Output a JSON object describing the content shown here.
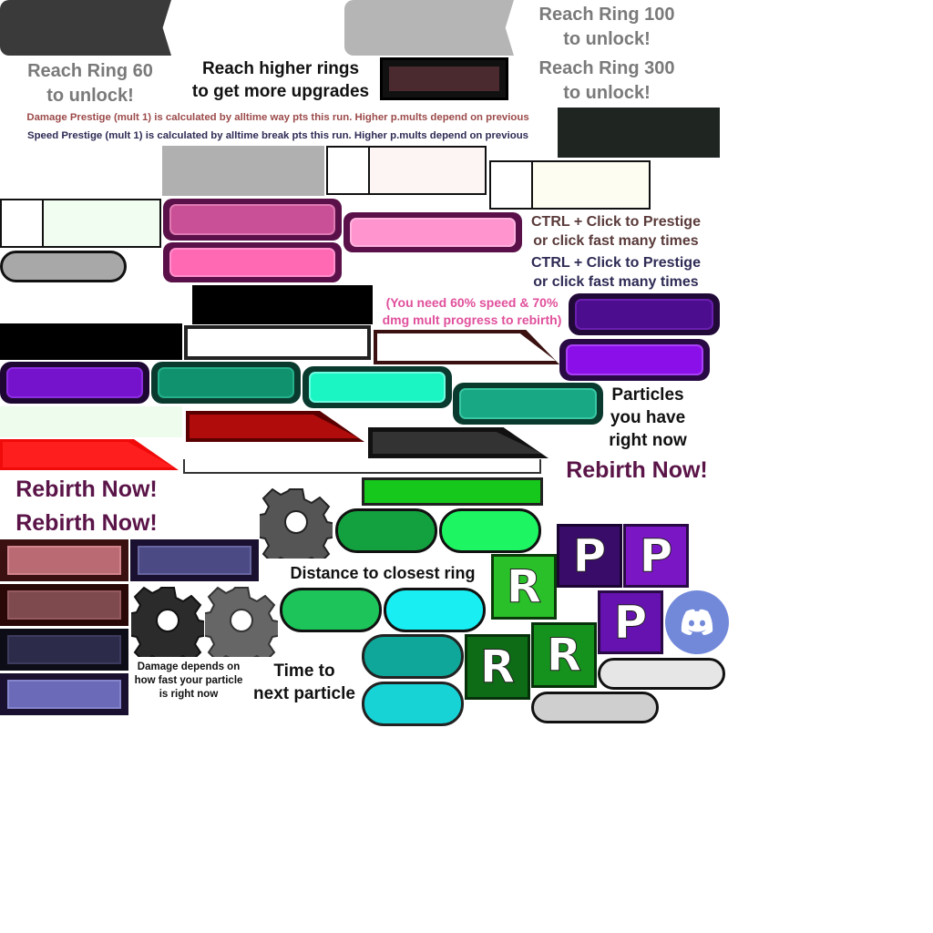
{
  "unlock_labels": {
    "ring60_line1": "Reach Ring 60",
    "ring60_line2": "to unlock!",
    "ring100_line1": "Reach Ring 100",
    "ring100_line2": "to unlock!",
    "ring300_line1": "Reach Ring 300",
    "ring300_line2": "to unlock!"
  },
  "upgrades_hint": {
    "line1": "Reach higher rings",
    "line2": "to get more upgrades"
  },
  "prestige_info": {
    "damage": "Damage Prestige (mult 1) is calculated by alltime way pts this run. Higher p.mults depend on previous",
    "speed": "Speed Prestige (mult 1) is calculated by alltime break pts this run. Higher p.mults depend on previous"
  },
  "prestige_hint_1": {
    "line1": "CTRL + Click to Prestige",
    "line2": "or click fast many times"
  },
  "prestige_hint_2": {
    "line1": "CTRL + Click to Prestige",
    "line2": "or click fast many times"
  },
  "rebirth_requirement": {
    "line1": "(You need 60% speed & 70%",
    "line2": "dmg mult progress to rebirth)"
  },
  "particles_label": {
    "line1": "Particles",
    "line2": "you have",
    "line3": "right now"
  },
  "rebirth_buttons": {
    "right": "Rebirth Now!",
    "left_top": "Rebirth Now!",
    "left_bottom": "Rebirth Now!"
  },
  "distance_label": "Distance to closest ring",
  "time_label": {
    "line1": "Time to",
    "line2": "next particle"
  },
  "damage_info": {
    "line1": "Damage depends on",
    "line2": "how fast your particle",
    "line3": "is right now"
  },
  "tiles": {
    "prestige_letter": "P",
    "rebirth_letter": "R"
  },
  "colors": {
    "dark_grey": "#3a3a3a",
    "light_grey": "#b5b5b5",
    "pink": "#ff6bc0",
    "purple": "#7b0fd6",
    "teal": "#0f8f6f",
    "mint": "#19f5c3",
    "green": "#1fc54a",
    "cyan": "#18eef0",
    "red": "#f00a0a",
    "discord": "#7289da"
  },
  "icons": [
    "gear-icon",
    "discord-icon"
  ]
}
